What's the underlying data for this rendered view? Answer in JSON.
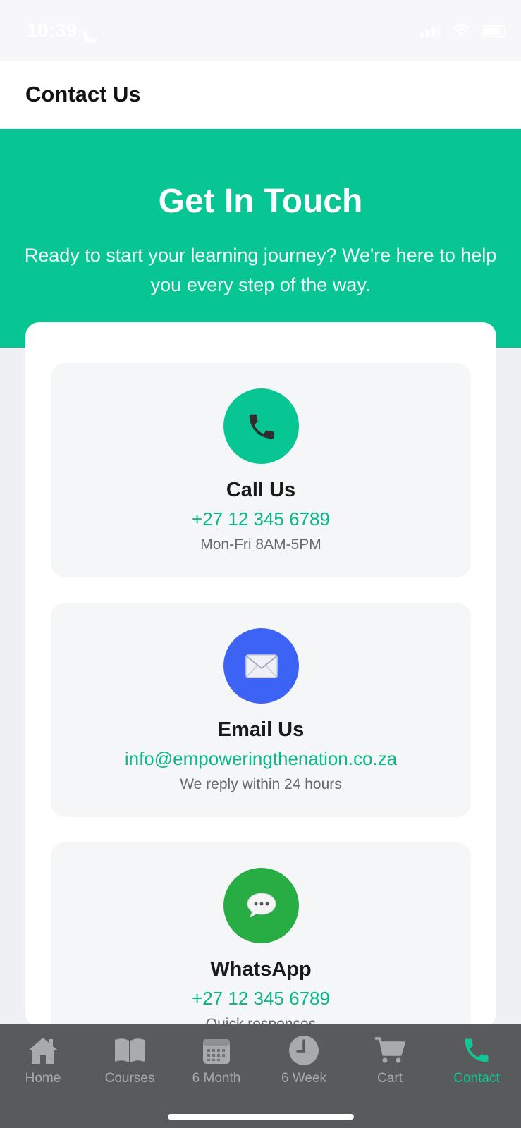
{
  "status_bar": {
    "time": "10:39"
  },
  "header": {
    "title": "Contact Us"
  },
  "hero": {
    "title": "Get In Touch",
    "subtitle": "Ready to start your learning journey? We're here to help you every step of the way."
  },
  "contact_methods": [
    {
      "icon": "phone-icon",
      "title": "Call Us",
      "value": "+27 12 345 6789",
      "note": "Mon-Fri 8AM-5PM",
      "icon_bg": "#08c594"
    },
    {
      "icon": "envelope-icon",
      "title": "Email Us",
      "value": "info@empoweringthenation.co.za",
      "note": "We reply within 24 hours",
      "icon_bg": "#3d63f5"
    },
    {
      "icon": "speech-bubble-icon",
      "title": "WhatsApp",
      "value": "+27 12 345 6789",
      "note": "Quick responses",
      "icon_bg": "#28ad45"
    }
  ],
  "tab_bar": {
    "tabs": [
      {
        "label": "Home",
        "icon": "home-icon"
      },
      {
        "label": "Courses",
        "icon": "book-icon"
      },
      {
        "label": "6 Month",
        "icon": "calendar-icon"
      },
      {
        "label": "6 Week",
        "icon": "clock-icon"
      },
      {
        "label": "Cart",
        "icon": "cart-icon"
      },
      {
        "label": "Contact",
        "icon": "phone-icon",
        "active": true
      }
    ]
  },
  "colors": {
    "accent": "#08c594",
    "tab_active": "#10c596",
    "tab_inactive": "#a9aaab",
    "tab_bar_bg": "#595a5b"
  }
}
